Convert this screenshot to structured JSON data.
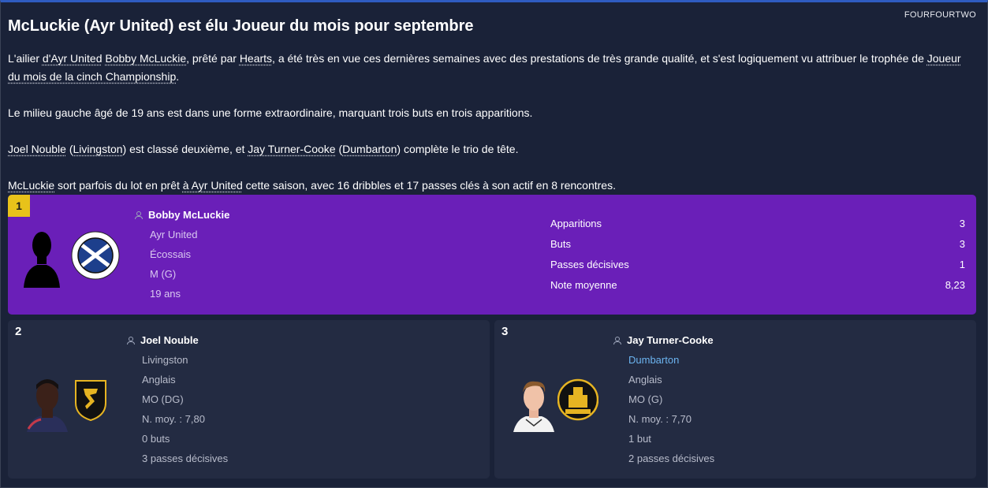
{
  "source": "FOURFOURTWO",
  "title": "McLuckie (Ayr United) est élu Joueur du mois pour septembre",
  "paragraphs": {
    "p1": {
      "t1": "L'ailier ",
      "l1": "d'Ayr United",
      "t2": " ",
      "l2": "Bobby McLuckie",
      "t3": ", prêté par ",
      "l3": "Hearts",
      "t4": ", a été très en vue ces dernières semaines avec des prestations de très grande qualité, et s'est logiquement vu attribuer le trophée de ",
      "l4": "Joueur du mois de la cinch Championship",
      "t5": "."
    },
    "p2": "Le milieu gauche âgé de 19 ans est dans une forme extraordinaire, marquant trois buts en trois apparitions.",
    "p3": {
      "l1": "Joel Nouble",
      "t1": " (",
      "l2": "Livingston",
      "t2": ") est classé deuxième, et ",
      "l3": "Jay Turner-Cooke",
      "t3": " (",
      "l4": "Dumbarton",
      "t4": ") complète le trio de tête."
    },
    "p4": {
      "l1": "McLuckie",
      "t1": " sort parfois du lot en prêt ",
      "l2": "à Ayr United",
      "t2": " cette saison, avec 16 dribbles et 17 passes clés à son actif en 8 rencontres."
    }
  },
  "winner": {
    "rank": "1",
    "name": "Bobby McLuckie",
    "club": "Ayr United",
    "nation": "Écossais",
    "position": "M (G)",
    "age": "19 ans",
    "stats": [
      {
        "label": "Apparitions",
        "value": "3"
      },
      {
        "label": "Buts",
        "value": "3"
      },
      {
        "label": "Passes décisives",
        "value": "1"
      },
      {
        "label": "Note moyenne",
        "value": "8,23"
      }
    ]
  },
  "second": {
    "rank": "2",
    "name": "Joel Nouble",
    "club": "Livingston",
    "nation": "Anglais",
    "position": "MO (DG)",
    "rating": "N. moy. : 7,80",
    "goals": "0 buts",
    "assists": "3 passes décisives"
  },
  "third": {
    "rank": "3",
    "name": "Jay Turner-Cooke",
    "club": "Dumbarton",
    "nation": "Anglais",
    "position": "MO (G)",
    "rating": "N. moy. : 7,70",
    "goals": "1 but",
    "assists": "2 passes décisives"
  },
  "colors": {
    "background": "#1a2238",
    "winner_card": "#6a1fb8",
    "card": "#232b42",
    "rank_badge": "#e8c21a",
    "link": "#6cb4f0"
  }
}
